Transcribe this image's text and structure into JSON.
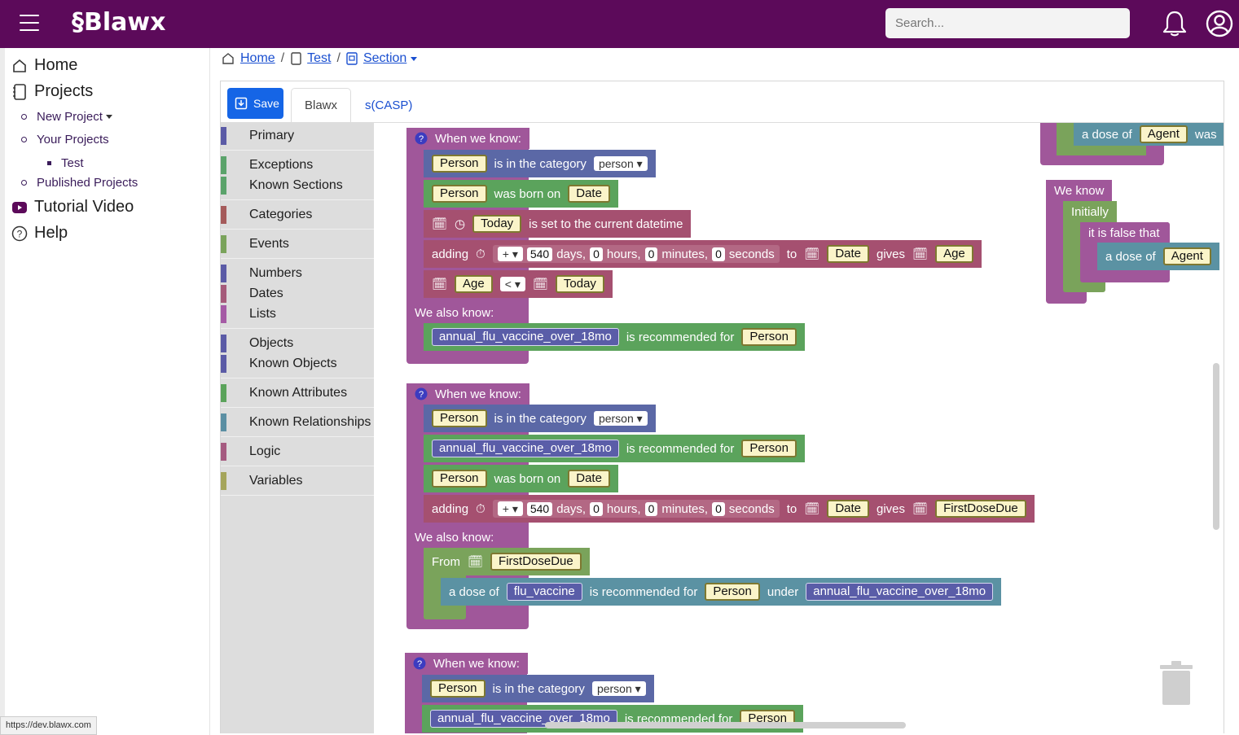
{
  "app": {
    "logo": "§Blawx"
  },
  "search": {
    "placeholder": "Search..."
  },
  "sidebar": {
    "home": "Home",
    "projects": "Projects",
    "new_project": "New Project",
    "your_projects": "Your Projects",
    "test": "Test",
    "published_projects": "Published Projects",
    "tutorial_video": "Tutorial Video",
    "help": "Help"
  },
  "breadcrumb": {
    "home": "Home",
    "test": "Test",
    "section": "Section"
  },
  "toolbar": {
    "save_label": "Save"
  },
  "tabs": {
    "blawx": "Blawx",
    "scasp": "s(CASP)"
  },
  "toolbox": [
    {
      "label": "Primary",
      "color": "#5b5ba6"
    },
    {
      "label": "Exceptions",
      "color": "#5ba36b"
    },
    {
      "label": "Known Sections",
      "color": "#5ba36b"
    },
    {
      "label": "Categories",
      "color": "#a55b5b"
    },
    {
      "label": "Events",
      "color": "#7aa35b"
    },
    {
      "label": "Numbers",
      "color": "#5b5ba6"
    },
    {
      "label": "Dates",
      "color": "#a55b7a"
    },
    {
      "label": "Lists",
      "color": "#a55ba5"
    },
    {
      "label": "Objects",
      "color": "#5b5ba6"
    },
    {
      "label": "Known Objects",
      "color": "#5b5ba6"
    },
    {
      "label": "Known Attributes",
      "color": "#5ba35b"
    },
    {
      "label": "Known Relationships",
      "color": "#5b8fa3"
    },
    {
      "label": "Logic",
      "color": "#a55b80"
    },
    {
      "label": "Variables",
      "color": "#a5a55b"
    }
  ],
  "workspace": {
    "when_we_know": "When we know:",
    "we_also_know": "We also know:",
    "we_know": "We know",
    "initially": "Initially",
    "it_is_false_that": "it is false that",
    "is_in_the_category": "is in the category",
    "person_category": "person",
    "was_born_on": "was born on",
    "is_set_to_current": "is set to the current datetime",
    "adding": "adding",
    "days": "days,",
    "hours": "hours,",
    "minutes": "minutes,",
    "seconds": "seconds",
    "to": "to",
    "gives": "gives",
    "is_recommended_for": "is recommended for",
    "from": "From",
    "a_dose_of": "a dose of",
    "under": "under",
    "was": "was",
    "plus": "+",
    "less_than": "<",
    "num_540": "540",
    "num_0": "0",
    "var_person": "Person",
    "var_date": "Date",
    "var_today": "Today",
    "var_age": "Age",
    "var_agent": "Agent",
    "var_first_dose_due": "FirstDoseDue",
    "annual_flu_vaccine": "annual_flu_vaccine_over_18mo",
    "flu_vaccine": "flu_vaccine",
    "truncated_annual": "annual_flu_vaccine_over_18mo",
    "truncated_recommended": "is recommended for"
  },
  "status_url": "https://dev.blawx.com"
}
